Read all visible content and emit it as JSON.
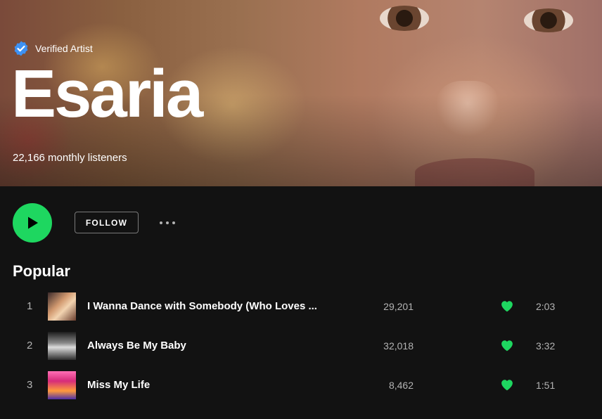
{
  "header": {
    "verified_label": "Verified Artist",
    "artist_name": "Esaria",
    "monthly_listeners": "22,166 monthly listeners"
  },
  "actions": {
    "play_icon": "play-icon",
    "follow_label": "FOLLOW",
    "more_icon": "more-horizontal-icon"
  },
  "popular": {
    "title": "Popular",
    "tracks": [
      {
        "index": "1",
        "title": "I Wanna Dance with Somebody (Who Loves ...",
        "plays": "29,201",
        "liked": true,
        "duration": "2:03"
      },
      {
        "index": "2",
        "title": "Always Be My Baby",
        "plays": "32,018",
        "liked": true,
        "duration": "3:32"
      },
      {
        "index": "3",
        "title": "Miss My Life",
        "plays": "8,462",
        "liked": true,
        "duration": "1:51"
      }
    ]
  },
  "colors": {
    "accent": "#1ed760",
    "background": "#121212",
    "verified_badge": "#3d91f4"
  }
}
